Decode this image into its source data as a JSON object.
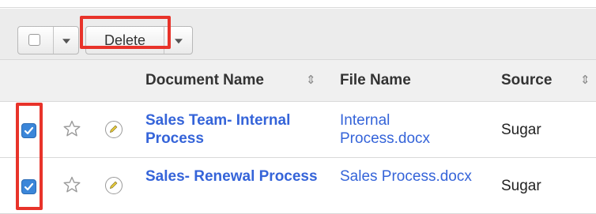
{
  "toolbar": {
    "delete_label": "Delete"
  },
  "table": {
    "columns": [
      "Document Name",
      "File Name",
      "Source"
    ],
    "rows": [
      {
        "document_name": "Sales Team- Internal Process",
        "file_name": "Internal Process.docx",
        "source": "Sugar",
        "selected": true
      },
      {
        "document_name": "Sales- Renewal Process",
        "file_name": "Sales Process.docx",
        "source": "Sugar",
        "selected": true
      }
    ]
  },
  "icons": {
    "sort": "sort-icon",
    "favorite": "star-icon",
    "edit": "pencil-icon",
    "dropdown": "chevron-down-icon"
  },
  "colors": {
    "link": "#3564d9",
    "checkbox_checked": "#3b86d9",
    "highlight": "#e8332a",
    "header_bg": "#f0f0f0"
  }
}
